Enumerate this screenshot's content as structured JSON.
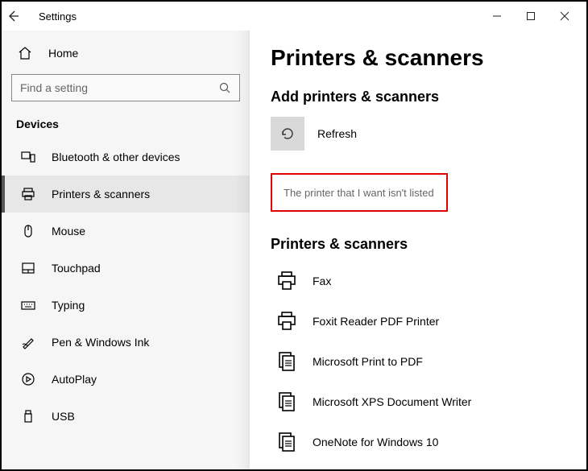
{
  "titlebar": {
    "title": "Settings"
  },
  "sidebar": {
    "home_label": "Home",
    "search_placeholder": "Find a setting",
    "section_label": "Devices",
    "items": [
      {
        "label": "Bluetooth & other devices"
      },
      {
        "label": "Printers & scanners"
      },
      {
        "label": "Mouse"
      },
      {
        "label": "Touchpad"
      },
      {
        "label": "Typing"
      },
      {
        "label": "Pen & Windows Ink"
      },
      {
        "label": "AutoPlay"
      },
      {
        "label": "USB"
      }
    ]
  },
  "main": {
    "heading": "Printers & scanners",
    "add_heading": "Add printers & scanners",
    "refresh_label": "Refresh",
    "not_listed_label": "The printer that I want isn't listed",
    "list_heading": "Printers & scanners",
    "printers": [
      {
        "label": "Fax"
      },
      {
        "label": "Foxit Reader PDF Printer"
      },
      {
        "label": "Microsoft Print to PDF"
      },
      {
        "label": "Microsoft XPS Document Writer"
      },
      {
        "label": "OneNote for Windows 10"
      }
    ]
  }
}
